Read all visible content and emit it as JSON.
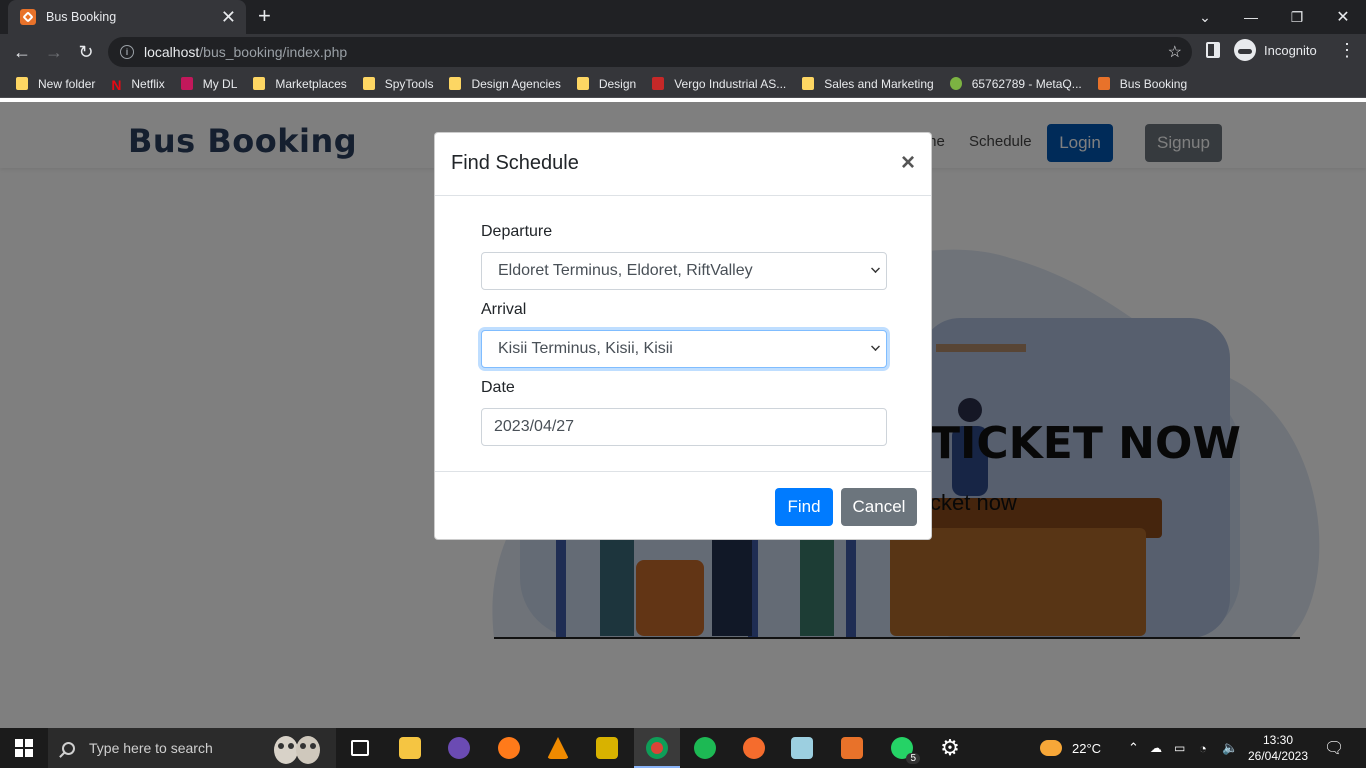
{
  "browser": {
    "tab_title": "Bus Booking",
    "tab_close": "✕",
    "new_tab": "+",
    "url_host": "localhost",
    "url_path": "/bus_booking/index.php",
    "incognito_label": "Incognito",
    "bookmarks": [
      {
        "label": "New folder",
        "icon": "folder-icon"
      },
      {
        "label": "Netflix",
        "icon": "netflix-icon"
      },
      {
        "label": "My DL",
        "icon": "mydl-icon"
      },
      {
        "label": "Marketplaces",
        "icon": "folder-icon"
      },
      {
        "label": "SpyTools",
        "icon": "folder-icon"
      },
      {
        "label": "Design Agencies",
        "icon": "folder-icon"
      },
      {
        "label": "Design",
        "icon": "folder-icon"
      },
      {
        "label": "Vergo Industrial AS...",
        "icon": "vergo-icon"
      },
      {
        "label": "Sales and Marketing",
        "icon": "folder-icon"
      },
      {
        "label": "65762789 - MetaQ...",
        "icon": "metaq-icon"
      },
      {
        "label": "Bus Booking",
        "icon": "xampp-icon"
      }
    ]
  },
  "site": {
    "brand": "Bus Booking",
    "nav_partial": "me",
    "nav_schedule": "Schedule",
    "login": "Login",
    "signup": "Signup",
    "hero_title": "TICKET NOW",
    "hero_sub": "cket now"
  },
  "modal": {
    "title": "Find Schedule",
    "close": "×",
    "departure_label": "Departure",
    "departure_value": "Eldoret Terminus, Eldoret, RiftValley",
    "arrival_label": "Arrival",
    "arrival_value": "Kisii Terminus, Kisii, Kisii",
    "date_label": "Date",
    "date_value": "2023/04/27",
    "find": "Find",
    "cancel": "Cancel"
  },
  "taskbar": {
    "search_placeholder": "Type here to search",
    "weather": "22°C",
    "time": "13:30",
    "date": "26/04/2023",
    "whatsapp_badge": "5"
  },
  "colors": {
    "primary": "#007bff",
    "secondary": "#6c757d",
    "brand": "#2a3f5f"
  }
}
